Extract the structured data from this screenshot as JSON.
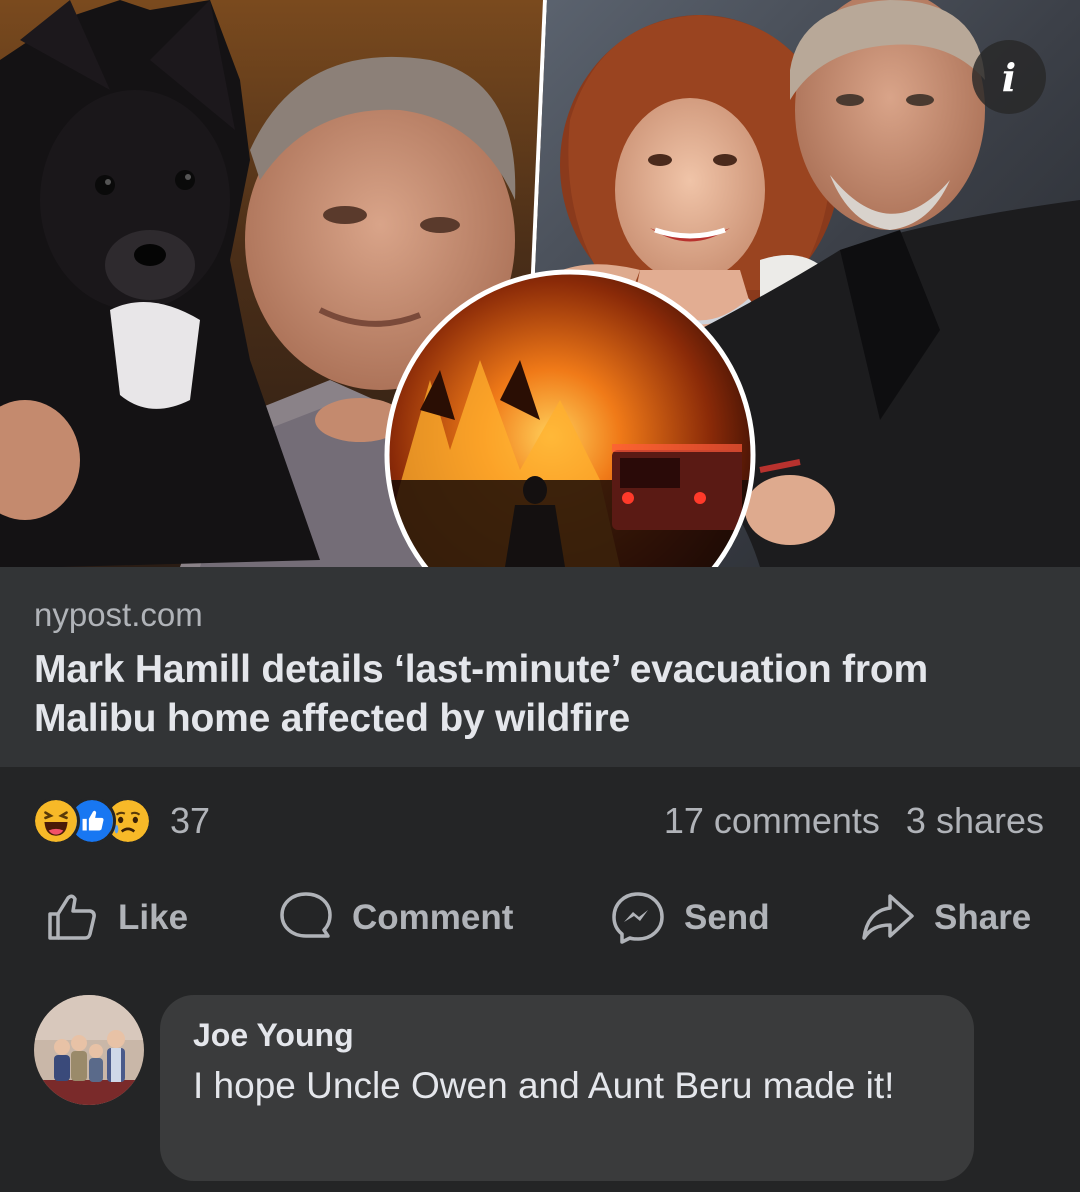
{
  "post": {
    "info_button": "i",
    "link": {
      "domain": "nypost.com",
      "title": "Mark Hamill details ‘last-minute’ evacuation from Malibu home affected by wildfire"
    },
    "reactions": {
      "types": [
        "haha",
        "like",
        "sad"
      ],
      "count": "37"
    },
    "counts": {
      "comments": "17 comments",
      "shares": "3 shares"
    },
    "actions": {
      "like": "Like",
      "comment": "Comment",
      "send": "Send",
      "share": "Share"
    },
    "comment": {
      "author": "Joe Young",
      "text": "I hope Uncle Owen and Aunt Beru made it!"
    }
  },
  "colors": {
    "background": "#242526",
    "link_preview_bg": "#323436",
    "comment_bubble_bg": "#3a3b3c",
    "primary_text": "#e4e6eb",
    "secondary_text": "#b0b3b8",
    "like_blue": "#1877f2",
    "haha_yellow": "#f7b928"
  },
  "icons": [
    "info-icon",
    "haha-reaction-icon",
    "like-reaction-icon",
    "sad-reaction-icon",
    "thumbs-up-icon",
    "comment-bubble-icon",
    "messenger-icon",
    "share-arrow-icon"
  ]
}
